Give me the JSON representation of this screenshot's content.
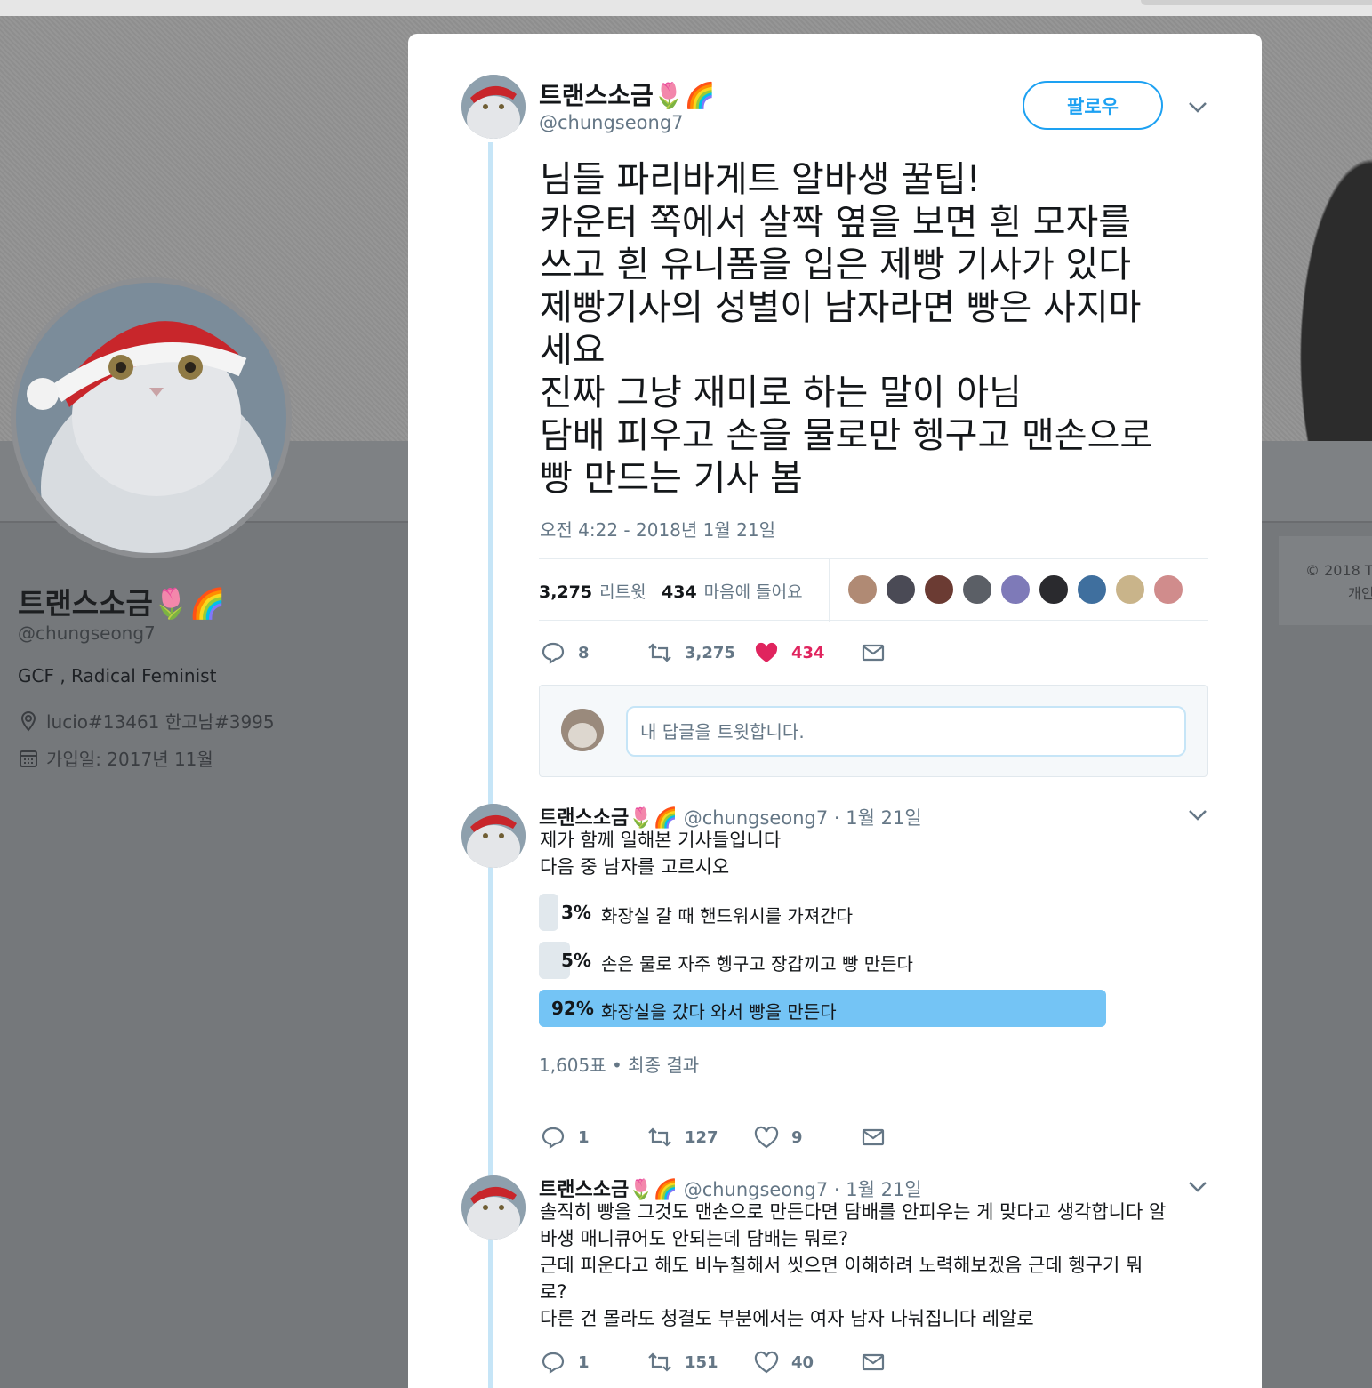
{
  "profile": {
    "name": "트랜스소금🌷🌈",
    "handle": "@chungseong7",
    "bio": "GCF , Radical Feminist",
    "location": "lucio#13461 한고남#3995",
    "joined": "가입일: 2017년 11월",
    "footer_line1": "© 2018 T",
    "footer_line2": "개인"
  },
  "tweet": {
    "name": "트랜스소금🌷🌈",
    "handle": "@chungseong7",
    "follow_label": "팔로우",
    "text": "님들 파리바게트 알바생 꿀팁!\n카운터 쪽에서 살짝 옆을 보면 흰 모자를\n쓰고 흰 유니폼을 입은 제빵 기사가 있다\n제빵기사의 성별이 남자라면 빵은 사지마\n세요\n진짜 그냥 재미로 하는 말이 아님\n담배 피우고 손을 물로만 헹구고 맨손으로\n빵 만드는 기사 봄",
    "time": "오전 4:22 - 2018년 1월 21일",
    "retweets_count": "3,275",
    "retweets_label": "리트윗",
    "likes_count": "434",
    "likes_label": "마음에 들어요",
    "actions": {
      "replies": "8",
      "retweets": "3,275",
      "likes": "434"
    }
  },
  "reply_box": {
    "placeholder": "내 답글을 트윗합니다."
  },
  "reply1": {
    "name": "트랜스소금🌷🌈",
    "handle": "@chungseong7",
    "date": "· 1월 21일",
    "text": "제가 함께 일해본 기사들입니다\n다음 중 남자를 고르시오",
    "poll": {
      "options": [
        {
          "pct": "3%",
          "label": "화장실 갈 때 핸드워시를 가져간다",
          "value": 3
        },
        {
          "pct": "5%",
          "label": "손은 물로 자주 헹구고 장갑끼고 빵 만든다",
          "value": 5
        },
        {
          "pct": "92%",
          "label": "화장실을 갔다 와서 빵을 만든다",
          "value": 92
        }
      ],
      "meta": "1,605표 • 최종 결과"
    },
    "actions": {
      "replies": "1",
      "retweets": "127",
      "likes": "9"
    }
  },
  "reply2": {
    "name": "트랜스소금🌷🌈",
    "handle": "@chungseong7",
    "date": "· 1월 21일",
    "text": "솔직히 빵을 그것도 맨손으로 만든다면 담배를 안피우는 게 맞다고 생각합니다 알\n바생 매니큐어도 안되는데 담배는 뭐로?\n근데 피운다고 해도 비누칠해서 씻으면 이해하려 노력해보겠음 근데 헹구기 뭐\n로?\n다른 건 몰라도 청결도 부분에서는 여자 남자 나눠집니다 레알로",
    "actions": {
      "replies": "1",
      "retweets": "151",
      "likes": "40"
    }
  },
  "colors": {
    "accent": "#1da1f2",
    "like": "#e0245e",
    "poll_winner": "#74c4f5",
    "poll_bar": "#e1e8ed",
    "thread_line": "#c6e5f7",
    "overlay": "#75787b"
  },
  "icons": [
    "location-icon",
    "calendar-icon",
    "reply-icon",
    "retweet-icon",
    "heart-icon",
    "mail-icon",
    "chevron-down-icon"
  ]
}
